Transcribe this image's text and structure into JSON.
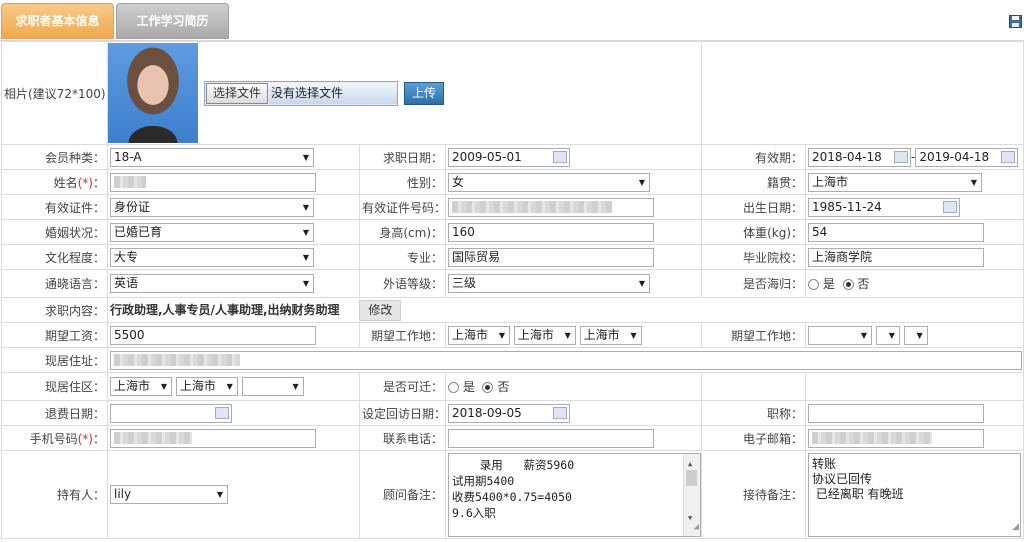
{
  "tabs": [
    {
      "label": "求职者基本信息"
    },
    {
      "label": "工作学习简历"
    }
  ],
  "photo": {
    "label": "相片(建议72*100)：",
    "file_button": "选择文件",
    "file_status": "没有选择文件",
    "upload": "上传"
  },
  "member_type": {
    "label": "会员种类：",
    "value": "18-A"
  },
  "job_date": {
    "label": "求职日期：",
    "value": "2009-05-01"
  },
  "valid_period": {
    "label": "有效期：",
    "from": "2018-04-18",
    "sep": "-",
    "to": "2019-04-18"
  },
  "name": {
    "label": "姓名",
    "req": "(*)",
    "colon": "："
  },
  "gender": {
    "label": "性别：",
    "value": "女"
  },
  "native_place": {
    "label": "籍贯：",
    "value": "上海市"
  },
  "id_type": {
    "label": "有效证件：",
    "value": "身份证"
  },
  "id_number": {
    "label": "有效证件号码："
  },
  "birth_date": {
    "label": "出生日期：",
    "value": "1985-11-24"
  },
  "marital": {
    "label": "婚姻状况：",
    "value": "已婚已育"
  },
  "height": {
    "label": "身高(cm)：",
    "value": "160"
  },
  "weight": {
    "label": "体重(kg)：",
    "value": "54"
  },
  "education": {
    "label": "文化程度：",
    "value": "大专"
  },
  "major": {
    "label": "专业：",
    "value": "国际贸易"
  },
  "school": {
    "label": "毕业院校：",
    "value": "上海商学院"
  },
  "language": {
    "label": "通晓语言：",
    "value": "英语"
  },
  "lang_level": {
    "label": "外语等级：",
    "value": "三级"
  },
  "returnee": {
    "label": "是否海归：",
    "yes": "是",
    "no": "否",
    "selected": "否"
  },
  "job_content": {
    "label": "求职内容：",
    "value": "行政助理,人事专员/人事助理,出纳财务助理",
    "edit": "修改"
  },
  "salary": {
    "label": "期望工资：",
    "value": "5500"
  },
  "work_place1": {
    "label": "期望工作地：",
    "p": "上海市",
    "c": "上海市",
    "d": "上海市"
  },
  "work_place2": {
    "label": "期望工作地："
  },
  "address": {
    "label": "现居住址："
  },
  "area": {
    "label": "现居住区：",
    "p": "上海市",
    "c": "上海市"
  },
  "relocate": {
    "label": "是否可迁：",
    "yes": "是",
    "no": "否",
    "selected": "否"
  },
  "refund_date": {
    "label": "退费日期："
  },
  "visit_date": {
    "label": "设定回访日期：",
    "value": "2018-09-05"
  },
  "title": {
    "label": "职称："
  },
  "mobile": {
    "label": "手机号码",
    "req": "(*)",
    "colon": "："
  },
  "phone": {
    "label": "联系电话："
  },
  "email": {
    "label": "电子邮箱："
  },
  "holder": {
    "label": "持有人：",
    "value": "lily"
  },
  "advisor_note": {
    "label": "顾问备注：",
    "text": "    录用   薪资5960\n试用期5400\n收费5400*0.75=4050\n9.6入职"
  },
  "reception_note": {
    "label": "接待备注：",
    "text": "转账\n协议已回传\n 已经离职 有晚班"
  }
}
